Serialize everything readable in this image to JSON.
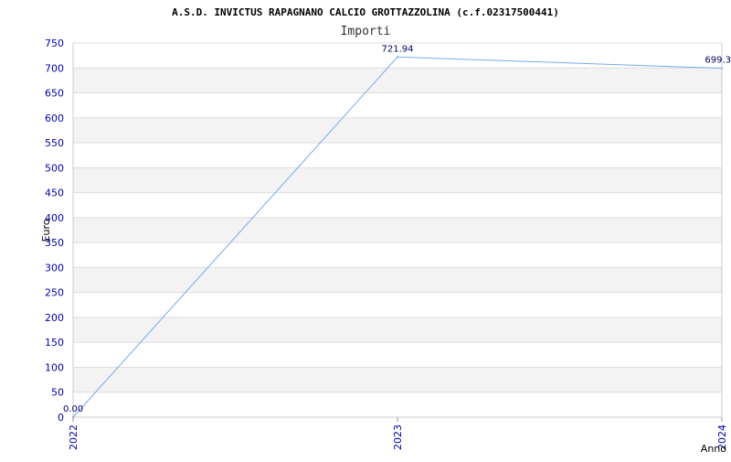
{
  "chart_data": {
    "type": "line",
    "title": "A.S.D. INVICTUS RAPAGNANO CALCIO GROTTAZZOLINA (c.f.02317500441)",
    "subtitle": "Importi",
    "xlabel": "Anno",
    "ylabel": "Euro",
    "categories": [
      "2022",
      "2023",
      "2024"
    ],
    "values": [
      0,
      721.94,
      699.3
    ],
    "data_labels": [
      "0.00",
      "721.94",
      "699.3"
    ],
    "ylim": [
      0,
      750
    ],
    "yticks": [
      "0",
      "50",
      "100",
      "150",
      "200",
      "250",
      "300",
      "350",
      "400",
      "450",
      "500",
      "550",
      "600",
      "650",
      "700",
      "750"
    ],
    "grid": true,
    "colors": {
      "line": "#77aaee",
      "band": "#f3f3f3",
      "grid": "#dddddd",
      "tick_text": "#0000aa",
      "data_label": "#000066"
    }
  }
}
